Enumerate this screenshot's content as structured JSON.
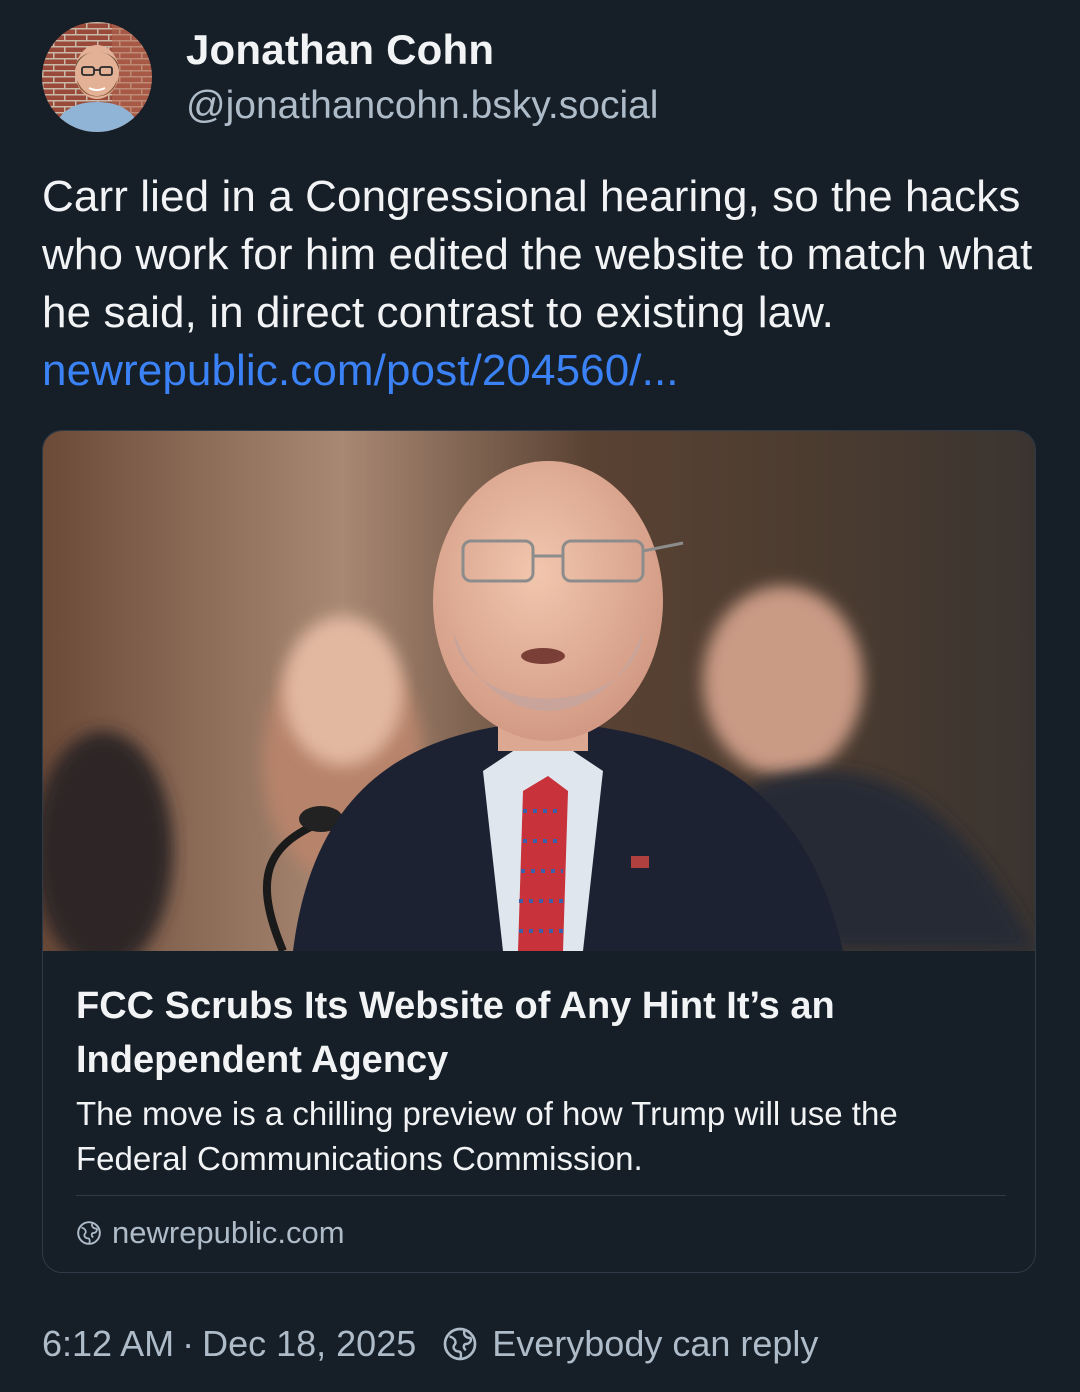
{
  "author": {
    "display_name": "Jonathan Cohn",
    "handle": "@jonathancohn.bsky.social"
  },
  "post": {
    "text": "Carr lied in a Congressional hearing, so the hacks who work for him edited the website to match what he said, in direct contrast to existing law. ",
    "link_text": "newrepublic.com/post/204560/..."
  },
  "embed": {
    "title": "FCC Scrubs Its Website of Any Hint It’s an Independent Agency",
    "description": "The move is a chilling preview of how Trump will use the Federal Communications Commission.",
    "domain": "newrepublic.com"
  },
  "meta": {
    "time": "6:12 AM",
    "separator": "·",
    "date": "Dec 18, 2025",
    "reply_setting": "Everybody can reply"
  },
  "colors": {
    "background": "#161e27",
    "text": "#f1f3f5",
    "secondary_text": "#aebbc9",
    "link": "#3b82f6",
    "border": "#2e3a48"
  },
  "icons": {
    "globe": "globe-icon",
    "reply_setting": "globe-icon"
  }
}
